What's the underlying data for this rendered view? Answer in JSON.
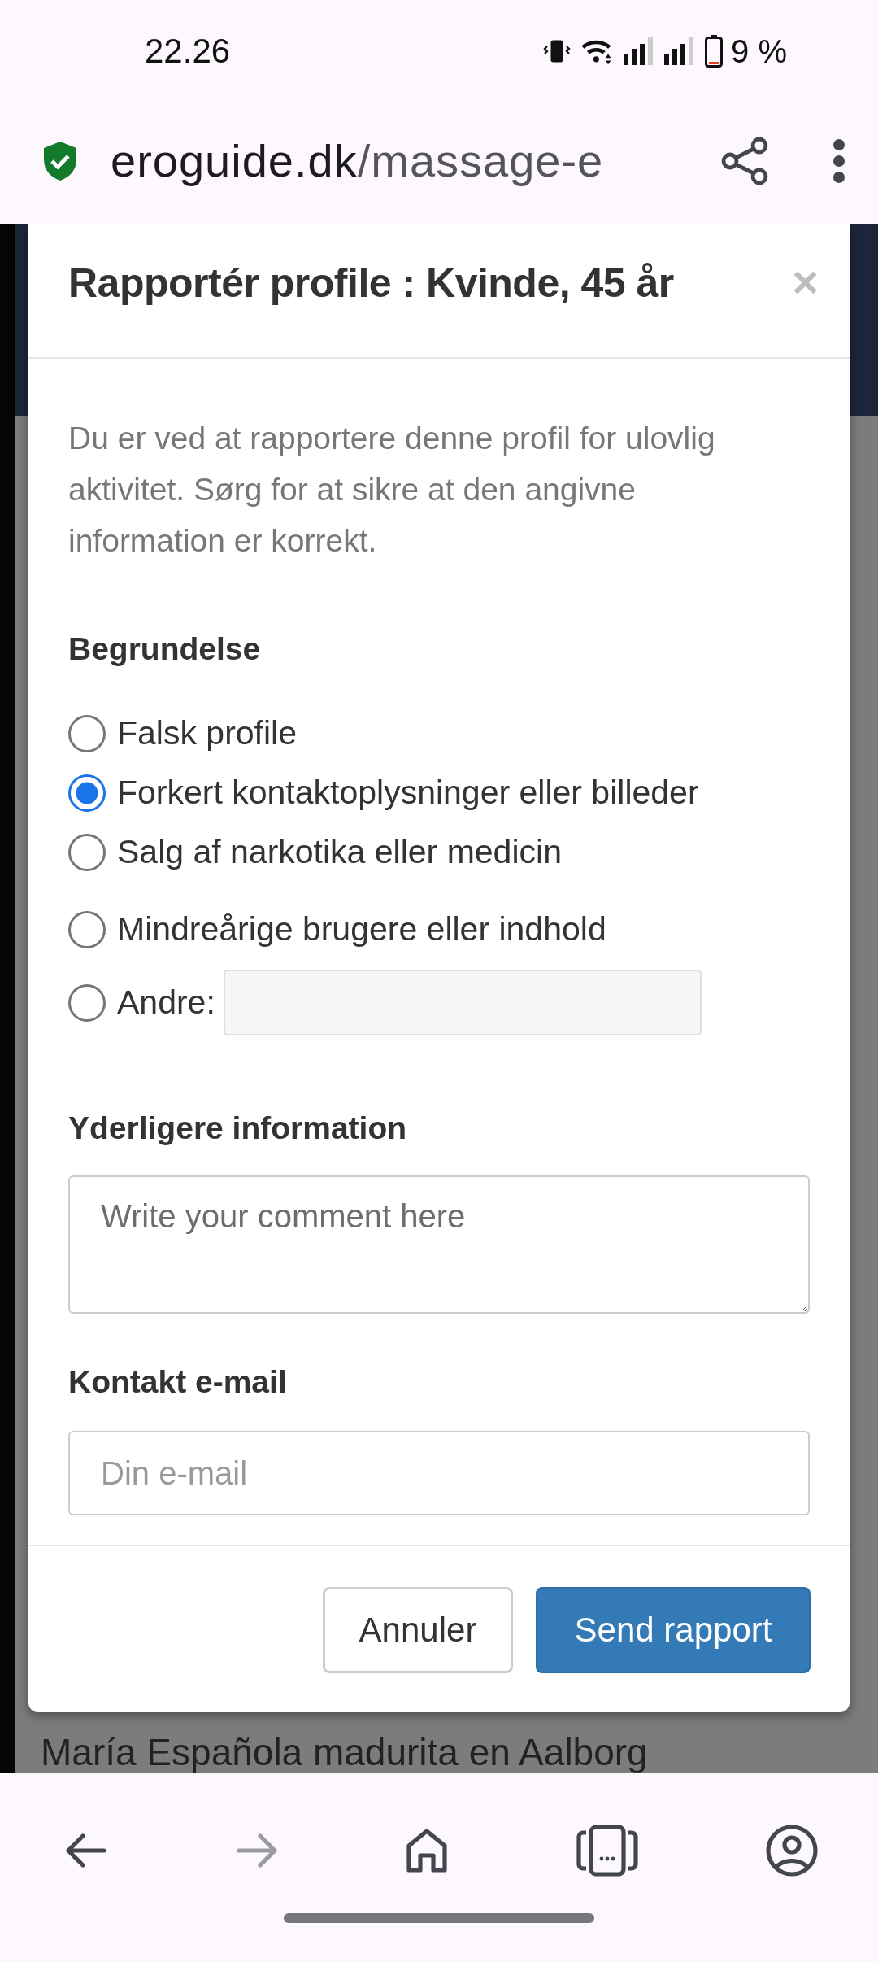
{
  "status_bar": {
    "time": "22.26",
    "battery": "9 %"
  },
  "address_bar": {
    "secure": true,
    "host": "eroguide.dk",
    "path": "/massage-e"
  },
  "background_text": "María Española madurita en Aalborg",
  "dialog": {
    "title": "Rapportér profile : Kvinde, 45 år",
    "close": "×",
    "intro": "Du er ved at rapportere denne profil for ulovlig aktivitet. Sørg for at sikre at den angivne information er korrekt.",
    "reason_label": "Begrundelse",
    "reasons": [
      {
        "kind": "radio",
        "label": "Falsk profile",
        "selected": false
      },
      {
        "kind": "radio",
        "label": "Forkert kontaktoplysninger eller billeder",
        "selected": true
      },
      {
        "kind": "radio",
        "label": "Salg af narkotika eller medicin",
        "selected": false
      },
      {
        "kind": "radio",
        "label": "Mindreårige brugere eller indhold",
        "selected": false
      },
      {
        "kind": "other",
        "label": "Andre:",
        "selected": false
      }
    ],
    "info_label": "Yderligere information",
    "info_placeholder": "Write your comment here",
    "email_label": "Kontakt e-mail",
    "email_placeholder": "Din e-mail",
    "buttons": [
      {
        "kind": "secondary",
        "label": "Annuler"
      },
      {
        "kind": "primary",
        "label": "Send rapport"
      }
    ]
  },
  "nav": [
    {
      "kind": "back",
      "disabled": false
    },
    {
      "kind": "forward",
      "disabled": true
    },
    {
      "kind": "home",
      "disabled": false
    },
    {
      "kind": "tabs",
      "disabled": false
    },
    {
      "kind": "account",
      "disabled": false
    }
  ]
}
